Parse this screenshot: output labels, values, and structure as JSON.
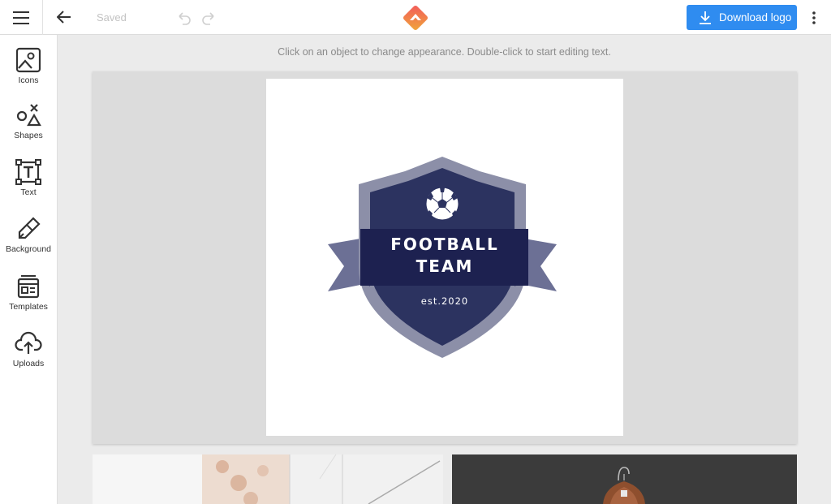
{
  "header": {
    "saved_label": "Saved",
    "download_label": "Download logo",
    "icons": [
      "menu-icon",
      "back-arrow-icon",
      "undo-icon",
      "redo-icon",
      "brand-logo",
      "download-icon",
      "more-vert-icon"
    ],
    "accent_color": "#2f8cf0"
  },
  "sidebar": {
    "items": [
      {
        "label": "Icons",
        "icon": "image-icon"
      },
      {
        "label": "Shapes",
        "icon": "shapes-icon"
      },
      {
        "label": "Text",
        "icon": "text-icon"
      },
      {
        "label": "Background",
        "icon": "brush-icon"
      },
      {
        "label": "Templates",
        "icon": "templates-icon"
      },
      {
        "label": "Uploads",
        "icon": "upload-icon"
      }
    ]
  },
  "canvas": {
    "hint": "Click on an object to change appearance. Double-click to start editing text.",
    "logo": {
      "title_line1": "FOOTBALL",
      "title_line2": "TEAM",
      "subtitle": "est.2020",
      "colors": {
        "shield_outer": "#8c8fa8",
        "shield_inner": "#2c3360",
        "banner": "#1d2150",
        "ribbon": "#6c7095"
      }
    }
  }
}
